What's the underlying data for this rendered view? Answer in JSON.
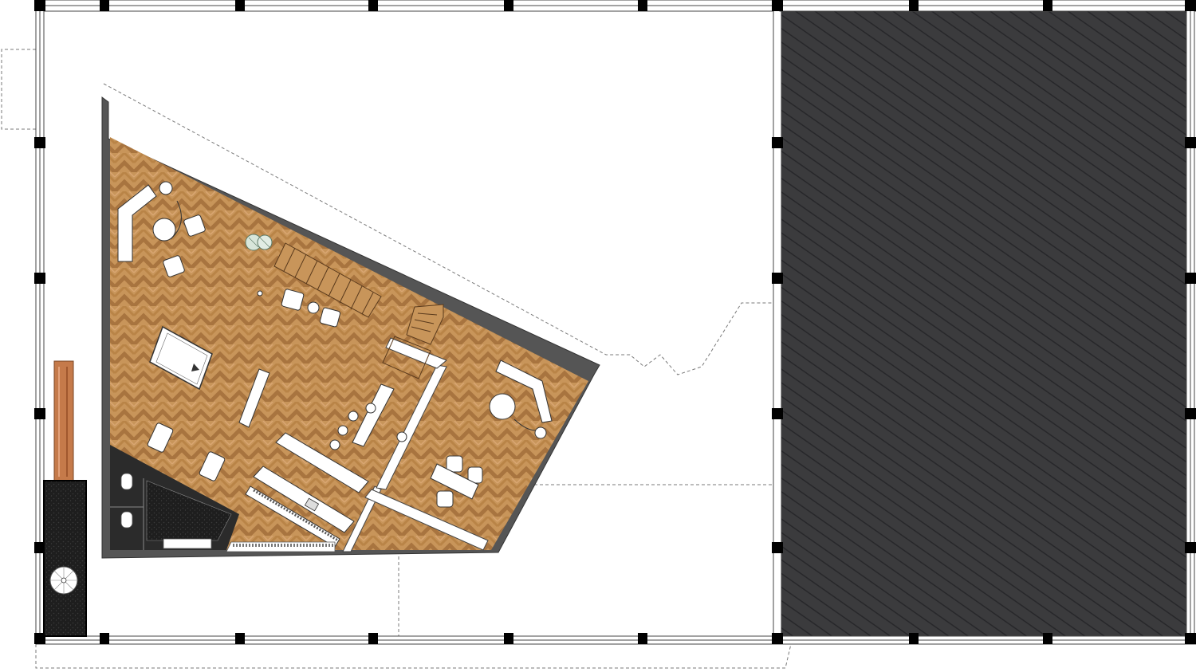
{
  "drawing": {
    "kind": "architectural floor plan",
    "colors": {
      "background": "#ffffff",
      "wall": "#555555",
      "wall_dark": "#1f1f1f",
      "column": "#000000",
      "hatch_fill": "#3b3b3d",
      "hatch_line": "#2a2a2c",
      "parquet_light": "#c8955a",
      "parquet_dark": "#a8743f",
      "bathroom": "#2c2c2c",
      "copper": "#c57a4a",
      "furniture": "#ffffff",
      "outline": "#333333",
      "dashed": "#7a7a7a"
    },
    "text_labels": []
  }
}
